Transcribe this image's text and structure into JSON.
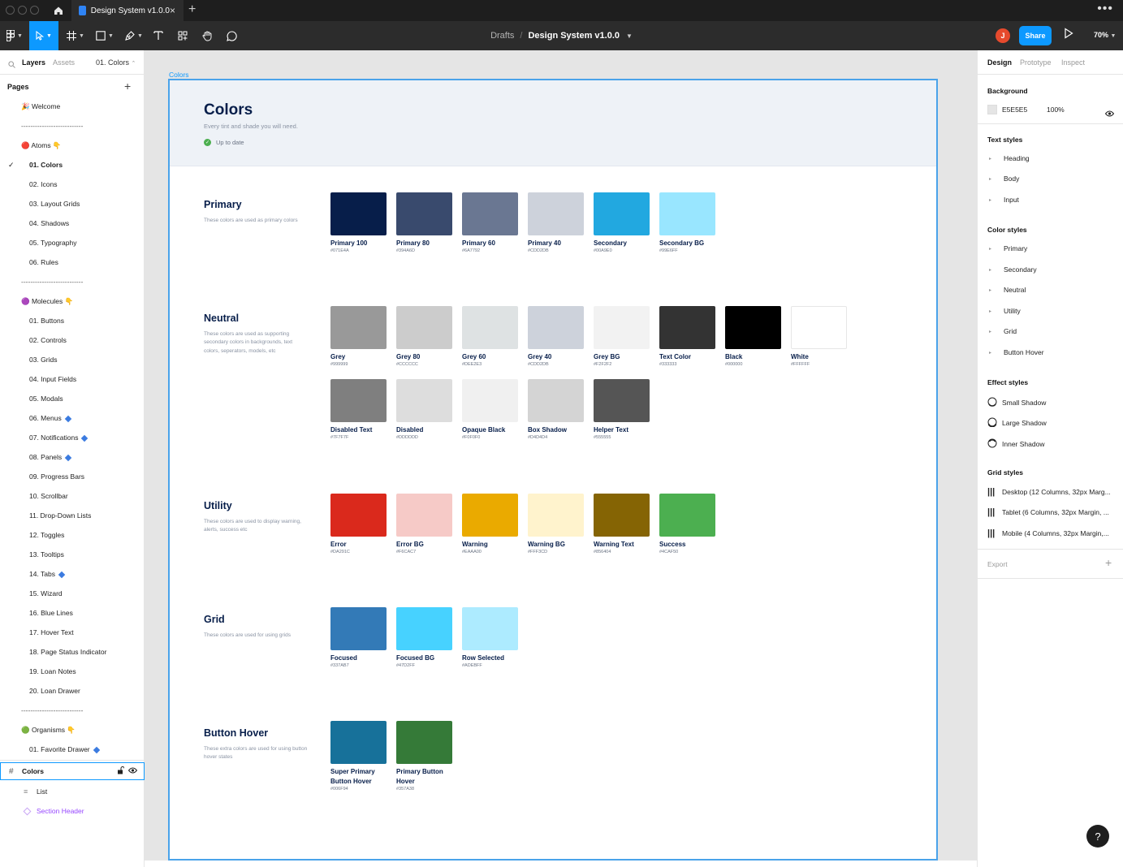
{
  "titlebar": {
    "tab_label": "Design System v1.0.0",
    "tab_close": "×",
    "new_tab": "+",
    "more": "•••"
  },
  "toolbar": {
    "crumb_parent": "Drafts",
    "crumb_sep": "/",
    "crumb_file": "Design System v1.0.0",
    "avatar": "J",
    "share": "Share",
    "zoom": "70%"
  },
  "left_panel": {
    "tabs": [
      "Layers",
      "Assets"
    ],
    "current_page": "01. Colors",
    "pages_heading": "Pages",
    "pages": [
      {
        "label": "🎉 Welcome"
      },
      {
        "label": "---------------------------"
      },
      {
        "label": "🔴 Atoms 👇"
      },
      {
        "label": "01. Colors"
      },
      {
        "label": "02. Icons"
      },
      {
        "label": "03. Layout Grids"
      },
      {
        "label": "04. Shadows"
      },
      {
        "label": "05. Typography"
      },
      {
        "label": "06. Rules"
      },
      {
        "label": "---------------------------"
      },
      {
        "label": "🟣 Molecules 👇"
      },
      {
        "label": "01. Buttons"
      },
      {
        "label": "02. Controls"
      },
      {
        "label": "03. Grids"
      },
      {
        "label": "04. Input Fields"
      },
      {
        "label": "05. Modals"
      },
      {
        "label": "06. Menus"
      },
      {
        "label": "07. Notifications"
      },
      {
        "label": "08. Panels"
      },
      {
        "label": "09. Progress Bars"
      },
      {
        "label": "10. Scrollbar"
      },
      {
        "label": "11. Drop-Down Lists"
      },
      {
        "label": "12. Toggles"
      },
      {
        "label": "13. Tooltips"
      },
      {
        "label": "14. Tabs"
      },
      {
        "label": "15. Wizard"
      },
      {
        "label": "16. Blue Lines"
      },
      {
        "label": "17. Hover Text"
      },
      {
        "label": "18. Page Status Indicator"
      },
      {
        "label": "19. Loan Notes"
      },
      {
        "label": "20. Loan Drawer"
      },
      {
        "label": "---------------------------"
      },
      {
        "label": "🟢 Organisms 👇"
      },
      {
        "label": "01. Favorite Drawer"
      }
    ],
    "layers": [
      {
        "label": "Colors"
      },
      {
        "label": "List"
      },
      {
        "label": "Section Header"
      }
    ]
  },
  "canvas": {
    "frame_label": "Colors",
    "title": "Colors",
    "subtitle": "Every tint and shade you will need.",
    "status": "Up to date",
    "sections": [
      {
        "title": "Primary",
        "desc": "These colors are used as primary colors",
        "swatches": [
          {
            "name": "Primary 100",
            "hex": "#071E4A",
            "color": "#071E4A"
          },
          {
            "name": "Primary 80",
            "hex": "#394A6D",
            "color": "#394A6D"
          },
          {
            "name": "Primary 60",
            "hex": "#6A7792",
            "color": "#6A7792"
          },
          {
            "name": "Primary 40",
            "hex": "#CDD2DB",
            "color": "#CDD2DB"
          },
          {
            "name": "Secondary",
            "hex": "#00A9E0",
            "color": "#22A8E0"
          },
          {
            "name": "Secondary BG",
            "hex": "#99E6FF",
            "color": "#99E6FF"
          }
        ]
      },
      {
        "title": "Neutral",
        "desc": "These colors are used as supporting secondary colors in backgrounds, text colors, seperators, models, etc",
        "swatches": [
          {
            "name": "Grey",
            "hex": "#999999",
            "color": "#999999"
          },
          {
            "name": "Grey 80",
            "hex": "#CCCCCC",
            "color": "#CCCCCC"
          },
          {
            "name": "Grey 60",
            "hex": "#DEE2E3",
            "color": "#DEE2E3"
          },
          {
            "name": "Grey 40",
            "hex": "#CDD2DB",
            "color": "#CDD2DB"
          },
          {
            "name": "Grey BG",
            "hex": "#F2F2F2",
            "color": "#F2F2F2"
          },
          {
            "name": "Text Color",
            "hex": "#333333",
            "color": "#333333"
          },
          {
            "name": "Black",
            "hex": "#000000",
            "color": "#000000"
          },
          {
            "name": "White",
            "hex": "#FFFFFF",
            "color": "#FFFFFF"
          },
          {
            "name": "Disabled Text",
            "hex": "#7F7F7F",
            "color": "#7F7F7F"
          },
          {
            "name": "Disabled",
            "hex": "#DDDDDD",
            "color": "#DDDDDD"
          },
          {
            "name": "Opaque Black",
            "hex": "#F0F0F0",
            "color": "#F0F0F0"
          },
          {
            "name": "Box Shadow",
            "hex": "#D4D4D4",
            "color": "#D4D4D4"
          },
          {
            "name": "Helper Text",
            "hex": "#555555",
            "color": "#555555"
          }
        ]
      },
      {
        "title": "Utility",
        "desc": "These colors are used to display warning, alerts, success etc",
        "swatches": [
          {
            "name": "Error",
            "hex": "#DA291C",
            "color": "#DA291C"
          },
          {
            "name": "Error BG",
            "hex": "#F6CAC7",
            "color": "#F6CAC7"
          },
          {
            "name": "Warning",
            "hex": "#EAAA00",
            "color": "#EAAA00"
          },
          {
            "name": "Warning BG",
            "hex": "#FFF3CD",
            "color": "#FFF3CD"
          },
          {
            "name": "Warning Text",
            "hex": "#856404",
            "color": "#856404"
          },
          {
            "name": "Success",
            "hex": "#4CAF50",
            "color": "#4CAF50"
          }
        ]
      },
      {
        "title": "Grid",
        "desc": "These colors are used for using grids",
        "swatches": [
          {
            "name": "Focused",
            "hex": "#337AB7",
            "color": "#337AB7"
          },
          {
            "name": "Focused BG",
            "hex": "#47D2FF",
            "color": "#47D2FF"
          },
          {
            "name": "Row Selected",
            "hex": "#ADEBFF",
            "color": "#ADEBFF"
          }
        ]
      },
      {
        "title": "Button Hover",
        "desc": "These extra colors are used for using button hover states",
        "swatches": [
          {
            "name": "Super Primary Button Hover",
            "hex": "#006F94",
            "color": "#17719A"
          },
          {
            "name": "Primary Button Hover",
            "hex": "#357A38",
            "color": "#357A38"
          }
        ]
      }
    ]
  },
  "right_panel": {
    "tabs": [
      "Design",
      "Prototype",
      "Inspect"
    ],
    "background_heading": "Background",
    "background_hex": "E5E5E5",
    "background_opacity": "100%",
    "text_styles_heading": "Text styles",
    "text_styles": [
      "Heading",
      "Body",
      "Input"
    ],
    "color_styles_heading": "Color styles",
    "color_styles": [
      "Primary",
      "Secondary",
      "Neutral",
      "Utility",
      "Grid",
      "Button Hover"
    ],
    "effect_styles_heading": "Effect styles",
    "effect_styles": [
      "Small Shadow",
      "Large Shadow",
      "Inner Shadow"
    ],
    "grid_styles_heading": "Grid styles",
    "grid_styles": [
      "Desktop (12 Columns, 32px Marg...",
      "Tablet (6 Columns, 32px Margin, ...",
      "Mobile (4 Columns, 32px Margin,..."
    ],
    "export_heading": "Export"
  },
  "help": "?",
  "colors": {
    "accent": "#0d99ff",
    "navy": "#071e4a",
    "toolbar": "#2c2c2c"
  }
}
